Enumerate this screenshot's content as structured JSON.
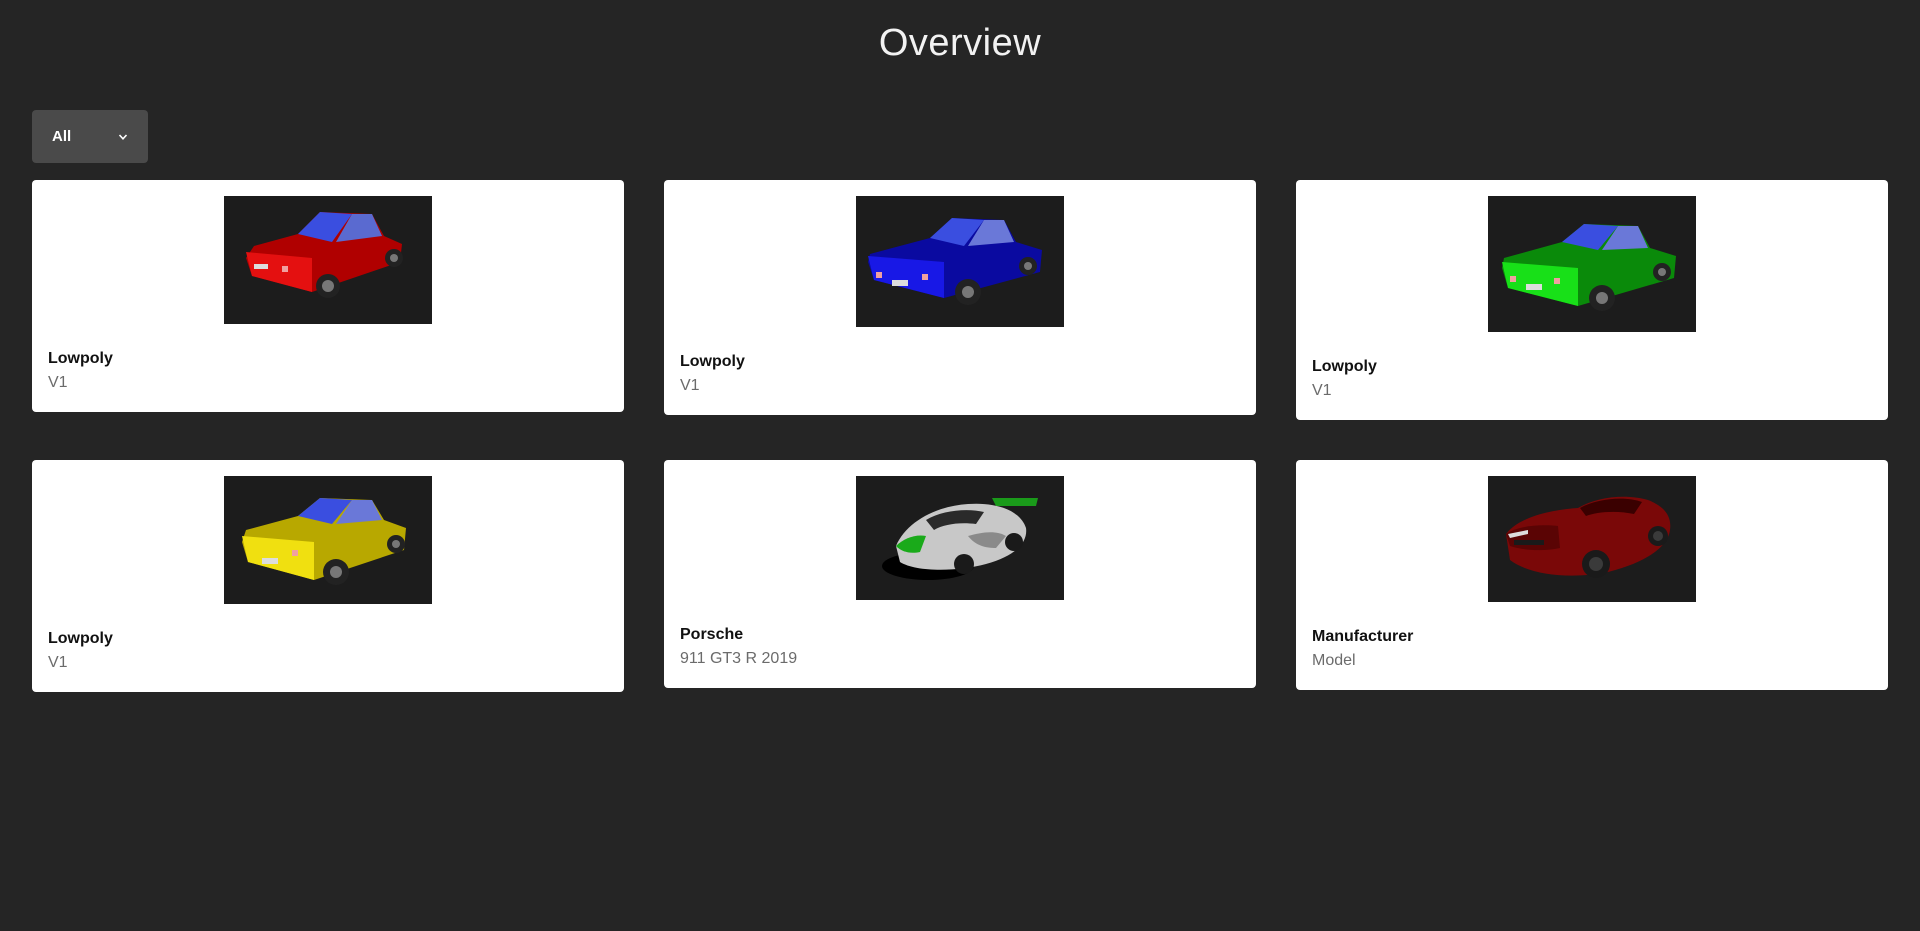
{
  "page": {
    "title": "Overview"
  },
  "filter": {
    "selected": "All"
  },
  "cards": [
    {
      "manufacturer": "Lowpoly",
      "model": "V1",
      "image": "red-lowpoly-car"
    },
    {
      "manufacturer": "Lowpoly",
      "model": "V1",
      "image": "blue-lowpoly-car"
    },
    {
      "manufacturer": "Lowpoly",
      "model": "V1",
      "image": "green-lowpoly-car"
    },
    {
      "manufacturer": "Lowpoly",
      "model": "V1",
      "image": "yellow-lowpoly-car"
    },
    {
      "manufacturer": "Porsche",
      "model": "911 GT3 R 2019",
      "image": "porsche-race-car"
    },
    {
      "manufacturer": "Manufacturer",
      "model": "Model",
      "image": "red-sports-car"
    }
  ],
  "colors": {
    "background": "#252525",
    "card": "#ffffff",
    "select": "#4a4a4a",
    "red_car": "#e00000",
    "blue_car": "#1010d8",
    "green_car": "#10d010",
    "yellow_car": "#e8d800",
    "sports_car": "#8a0a0a"
  }
}
